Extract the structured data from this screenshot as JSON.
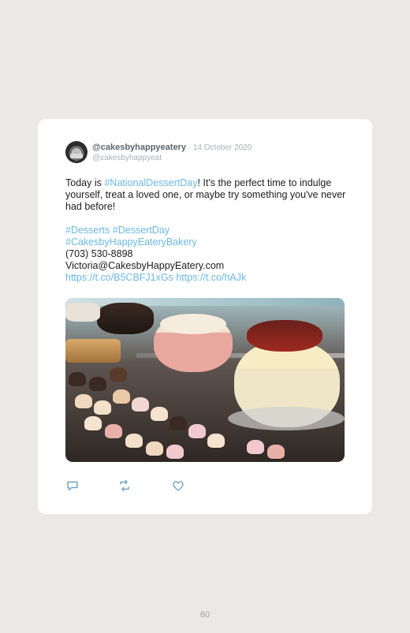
{
  "tweet": {
    "username": "@cakesbyhappyeatery",
    "separator": " · ",
    "date": "14 October 2020",
    "subhandle": "@cakesbyhappyeat",
    "text_before": "Today is ",
    "hashtag_national": "#NationalDessertDay",
    "text_after": "! It's the perfect time to indulge yourself, treat a loved one, or maybe try something you've never had before!",
    "hashtag_desserts": "#Desserts",
    "hashtag_dessertday": "#DessertDay",
    "hashtag_bakery": "#CakesbyHappyEateryBakery",
    "phone": "(703) 530-8898",
    "email": "Victoria@CakesbyHappyEatery.com",
    "link1": "https://t.co/B5CBFJ1xGs",
    "link2": "https://t.co/hAJk",
    "photo_alt": "Bakery display case with cakes and cupcakes"
  },
  "actions": {
    "reply_icon": "reply-icon",
    "retweet_icon": "retweet-icon",
    "like_icon": "heart-icon"
  },
  "footer": {
    "page_number": "60"
  },
  "colors": {
    "background": "#ede8e8",
    "link": "#6cb8e6",
    "username": "#5b6470",
    "muted": "#a9b0b8"
  }
}
